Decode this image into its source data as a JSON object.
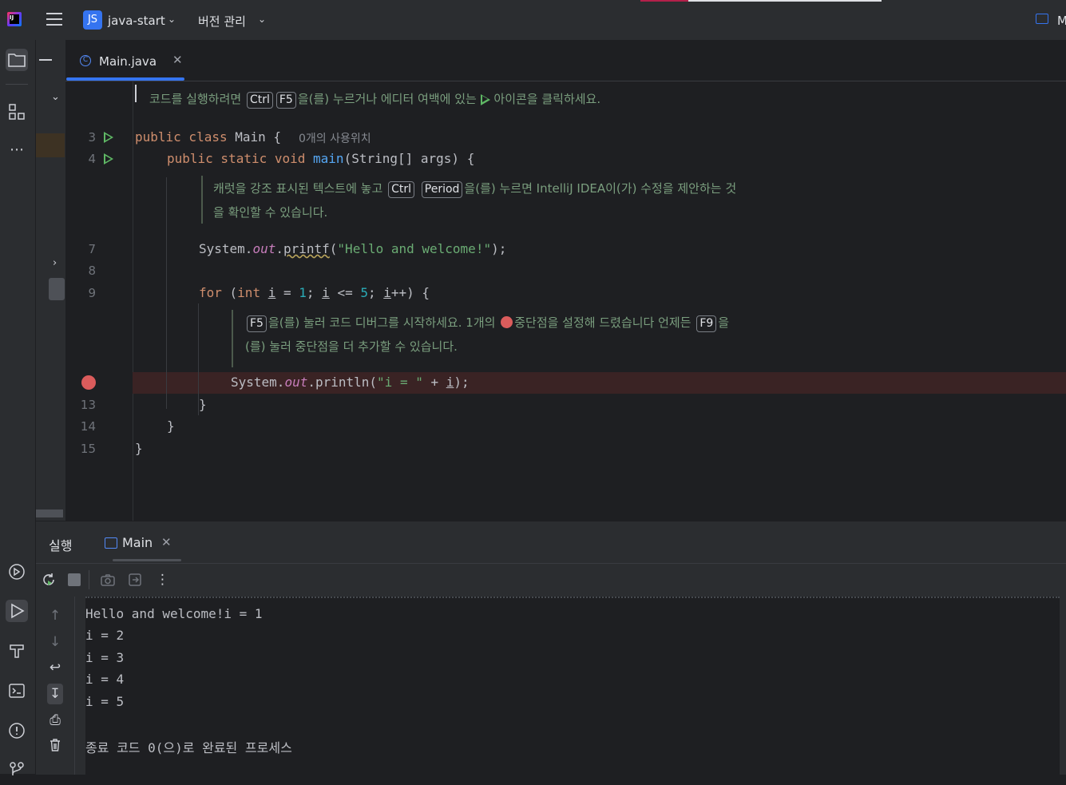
{
  "titlebar": {
    "app_logo": "IJ",
    "project_badge": "JS",
    "project_name": "java-start",
    "vcs_menu": "버전 관리",
    "right_label": "M"
  },
  "editor": {
    "tab_label": "Main.java",
    "tab_icon": "C",
    "hint_top": {
      "p1": "코드를 실행하려면",
      "k1": "Ctrl",
      "k2": "F5",
      "p2": "을(를) 누르거나 에디터 여백에 있는",
      "p3": "아이콘을 클릭하세요."
    },
    "hint_caret": {
      "p1": "캐럿을 강조 표시된 텍스트에 놓고",
      "k1": "Ctrl",
      "k2": "Period",
      "p2": "을(를) 누르면 IntelliJ IDEA이(가) 수정을 제안하는 것",
      "p3": "을 확인할 수 있습니다."
    },
    "hint_debug": {
      "k1": "F5",
      "p1": "을(를) 눌러 코드 디버그를 시작하세요. 1개의",
      "p2": "중단점을 설정해 드렸습니다 언제든",
      "k2": "F9",
      "p3": "을",
      "p4": "(를) 눌러 중단점을 더 추가할 수 있습니다."
    },
    "line_numbers": [
      "3",
      "4",
      "7",
      "8",
      "9",
      "13",
      "14",
      "15"
    ],
    "usages": "0개의 사용위치",
    "code": {
      "l3_kw": "public class ",
      "l3_name": "Main {",
      "l4_kw": "public static void ",
      "l4_fn": "main",
      "l4_rest": "(String[] args) {",
      "l7_a": "System.",
      "l7_out": "out",
      "l7_dot": ".",
      "l7_fn": "printf",
      "l7_open": "(",
      "l7_str": "\"Hello and welcome!\"",
      "l7_close": ");",
      "l9_for": "for",
      "l9_p1": " (",
      "l9_int": "int",
      "l9_sp": " ",
      "l9_i1": "i",
      "l9_eq": " = ",
      "l9_n1": "1",
      "l9_semi1": "; ",
      "l9_i2": "i",
      "l9_le": " <= ",
      "l9_n5": "5",
      "l9_semi2": "; ",
      "l9_i3": "i",
      "l9_end": "++) {",
      "l12_a": "System.",
      "l12_out": "out",
      "l12_b": ".println(",
      "l12_str": "\"i = \"",
      "l12_plus": " + ",
      "l12_i": "i",
      "l12_end": ");",
      "l13": "}",
      "l14": "}",
      "l15": "}"
    }
  },
  "run_panel": {
    "title": "실행",
    "tab_label": "Main",
    "console": [
      "Hello and welcome!i = 1",
      "i = 2",
      "i = 3",
      "i = 4",
      "i = 5",
      "",
      "종료 코드 0(으)로 완료된 프로세스"
    ]
  },
  "icons": {
    "leftbar": [
      "folder-icon",
      "structure-icon",
      "more-icon",
      "services-icon",
      "run-icon",
      "build-icon",
      "terminal-icon",
      "problems-icon",
      "git-icon"
    ]
  },
  "colors": {
    "accent": "#3574f0",
    "run_green": "#5fb865",
    "breakpoint_red": "#db5c5c"
  }
}
